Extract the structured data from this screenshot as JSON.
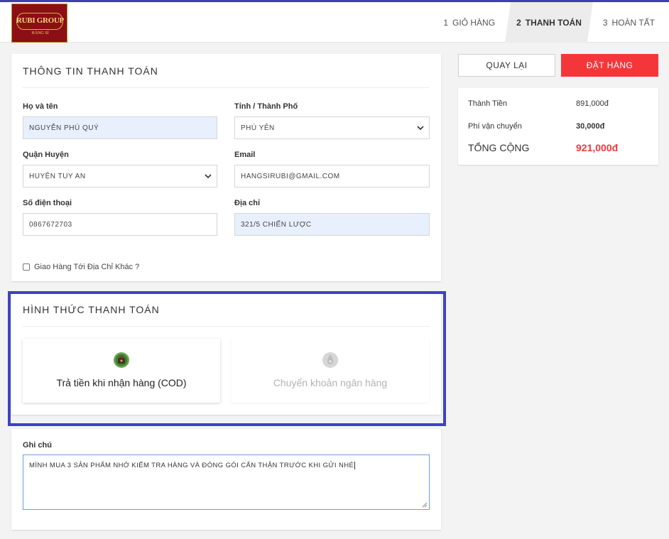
{
  "header": {
    "logo": {
      "line1": "RUBI GROUP",
      "line2": "HÀNG SỈ"
    },
    "steps": [
      {
        "num": "1",
        "label": "GIỎ HÀNG"
      },
      {
        "num": "2",
        "label": "THANH TOÁN"
      },
      {
        "num": "3",
        "label": "HOÀN TẤT"
      }
    ]
  },
  "billing": {
    "title": "THÔNG TIN THANH TOÁN",
    "name": {
      "label": "Họ và tên",
      "value": "NGUYỄN PHÚ QUÝ"
    },
    "province": {
      "label": "Tỉnh / Thành Phố",
      "value": "PHÚ YÊN"
    },
    "district": {
      "label": "Quận Huyện",
      "value": "HUYỆN TUY AN"
    },
    "email": {
      "label": "Email",
      "value": "HANGSIRUBI@GMAIL.COM"
    },
    "phone": {
      "label": "Số điện thoại",
      "value": "0867672703"
    },
    "address": {
      "label": "Địa chỉ",
      "value": "321/5 CHIẾN LƯỢC"
    },
    "ship_other": "Giao Hàng Tới Địa Chỉ Khác ?"
  },
  "payment": {
    "title": "HÌNH THỨC THANH TOÁN",
    "cod": "Trả tiền khi nhận hàng (COD)",
    "bank": "Chuyển khoản ngân hàng"
  },
  "note": {
    "label": "Ghi chú",
    "value": "MÌNH MUA 3 SẢN PHẨM NHỚ KIỂM TRA HÀNG VÀ ĐÓNG GÓI CẨN THẬN TRƯỚC KHI GỬI NHÉ"
  },
  "actions": {
    "back": "QUAY LẠI",
    "order": "ĐẶT HÀNG"
  },
  "summary": {
    "subtotal_label": "Thành Tiền",
    "subtotal": "891,000đ",
    "shipping_label": "Phí vận chuyển",
    "shipping": "30,000đ",
    "total_label": "TỔNG CỘNG",
    "total": "921,000đ"
  },
  "colors": {
    "accent": "#3f41c6",
    "order_button": "#f4363a",
    "total_text": "#f4363a",
    "autofill": "#e8f0fe"
  }
}
